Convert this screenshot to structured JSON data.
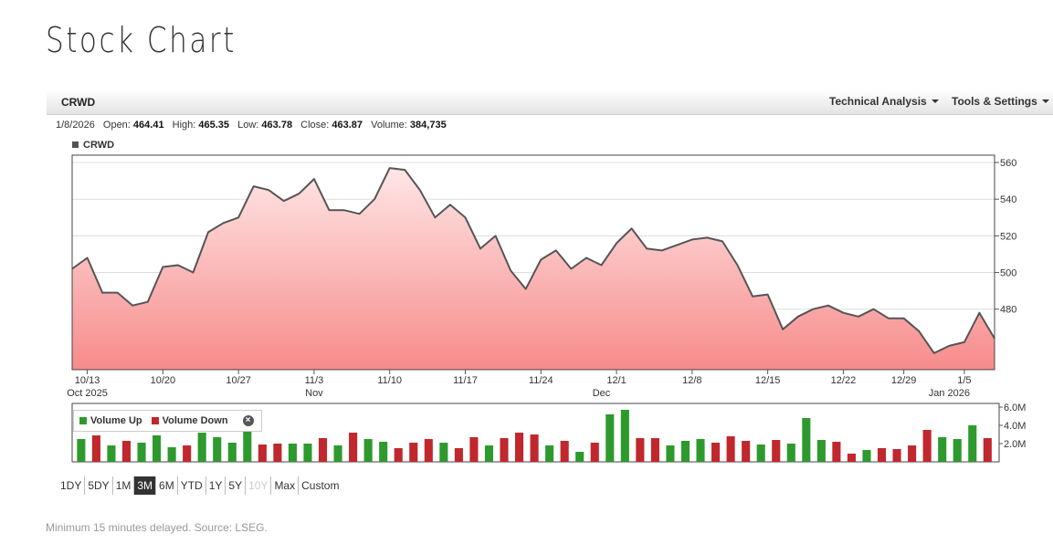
{
  "page_title": "Stock Chart",
  "toolbar": {
    "symbol": "CRWD",
    "technical_analysis": "Technical Analysis",
    "tools_settings": "Tools & Settings"
  },
  "quote": {
    "date": "1/8/2026",
    "open_label": "Open:",
    "open": "464.41",
    "high_label": "High:",
    "high": "465.35",
    "low_label": "Low:",
    "low": "463.78",
    "close_label": "Close:",
    "close": "463.87",
    "volume_label": "Volume:",
    "volume": "384,735"
  },
  "legend_main": "CRWD",
  "volume_legend": {
    "up": "Volume Up",
    "down": "Volume Down"
  },
  "colors": {
    "line": "#555555",
    "fill_top": "#ffe6e6",
    "fill_bottom": "#f78b8b",
    "vol_up": "#2e9a2e",
    "vol_down": "#c0282d"
  },
  "range_buttons": [
    {
      "label": "1DY",
      "state": "normal"
    },
    {
      "label": "5DY",
      "state": "normal"
    },
    {
      "label": "1M",
      "state": "normal"
    },
    {
      "label": "3M",
      "state": "active"
    },
    {
      "label": "6M",
      "state": "normal"
    },
    {
      "label": "YTD",
      "state": "normal"
    },
    {
      "label": "1Y",
      "state": "normal"
    },
    {
      "label": "5Y",
      "state": "normal"
    },
    {
      "label": "10Y",
      "state": "disabled"
    },
    {
      "label": "Max",
      "state": "normal"
    },
    {
      "label": "Custom",
      "state": "normal"
    }
  ],
  "footer": "Minimum 15 minutes delayed. Source: LSEG.",
  "chart_data": [
    {
      "type": "area",
      "series": [
        {
          "name": "CRWD",
          "values": [
            502,
            508,
            489,
            489,
            482,
            484,
            503,
            504,
            500,
            522,
            527,
            530,
            547,
            545,
            539,
            543,
            551,
            534,
            534,
            532,
            540,
            557,
            556,
            545,
            530,
            537,
            530,
            513,
            520,
            501,
            491,
            507,
            512,
            502,
            508,
            504,
            516,
            524,
            513,
            512,
            515,
            518,
            519,
            517,
            504,
            487,
            488,
            469,
            476,
            480,
            482,
            478,
            476,
            480,
            475,
            475,
            468,
            456,
            460,
            462,
            478,
            464
          ]
        }
      ],
      "x_tick_labels": [
        "10/13",
        "10/20",
        "10/27",
        "11/3",
        "11/10",
        "11/17",
        "11/24",
        "12/1",
        "12/8",
        "12/15",
        "12/22",
        "12/29",
        "1/5"
      ],
      "x_tick_index": [
        1,
        6,
        11,
        16,
        21,
        26,
        31,
        36,
        41,
        46,
        51,
        55,
        59
      ],
      "period_labels": [
        {
          "label": "Oct 2025",
          "index": 1
        },
        {
          "label": "Nov",
          "index": 16
        },
        {
          "label": "Dec",
          "index": 35
        },
        {
          "label": "Jan 2026",
          "index": 58
        }
      ],
      "y_ticks": [
        480,
        500,
        520,
        540,
        560
      ],
      "ylim": [
        447,
        564
      ],
      "grid": true
    },
    {
      "type": "bar",
      "series": [
        {
          "name": "Volume",
          "values": [
            2.5,
            2.9,
            1.8,
            2.3,
            2.1,
            2.9,
            1.6,
            1.8,
            3.2,
            2.7,
            2.1,
            3.4,
            1.9,
            2.0,
            2.0,
            2.0,
            2.6,
            1.8,
            3.2,
            2.5,
            2.2,
            1.5,
            2.1,
            2.5,
            2.1,
            1.5,
            2.7,
            1.8,
            2.6,
            3.2,
            3.0,
            1.8,
            2.3,
            1.1,
            2.1,
            5.2,
            5.7,
            2.6,
            2.6,
            1.8,
            2.3,
            2.5,
            2.1,
            2.8,
            2.3,
            1.9,
            2.4,
            2.0,
            4.8,
            2.4,
            2.2,
            0.9,
            1.3,
            1.5,
            1.4,
            1.8,
            3.5,
            2.7,
            2.5,
            4.0,
            2.6
          ],
          "direction": [
            "u",
            "d",
            "u",
            "d",
            "u",
            "u",
            "u",
            "d",
            "u",
            "u",
            "u",
            "u",
            "d",
            "d",
            "u",
            "u",
            "d",
            "u",
            "d",
            "u",
            "u",
            "d",
            "d",
            "d",
            "u",
            "d",
            "d",
            "u",
            "d",
            "d",
            "d",
            "u",
            "d",
            "u",
            "d",
            "u",
            "u",
            "d",
            "d",
            "u",
            "u",
            "u",
            "d",
            "d",
            "d",
            "u",
            "d",
            "u",
            "u",
            "u",
            "d",
            "d",
            "u",
            "d",
            "d",
            "d",
            "d",
            "u",
            "u",
            "u",
            "d"
          ]
        }
      ],
      "y_ticks": [
        2.0,
        4.0,
        6.0
      ],
      "y_tick_labels": [
        "2.0M",
        "4.0M",
        "6.0M"
      ],
      "ylim": [
        0,
        6.4
      ],
      "unit": "M"
    }
  ]
}
